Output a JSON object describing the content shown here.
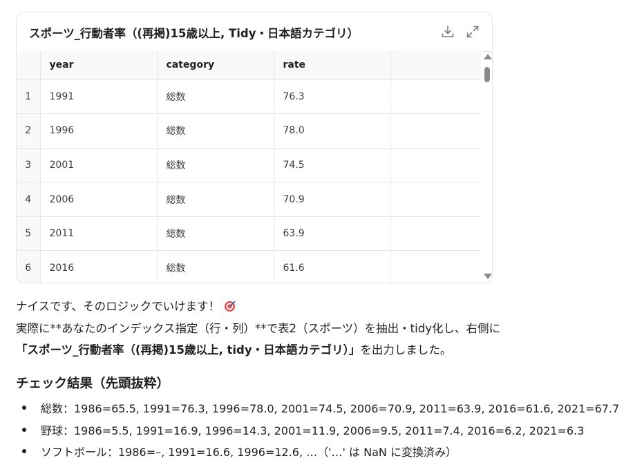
{
  "card": {
    "title": "スポーツ_行動者率（(再掲)15歳以上, Tidy・日本語カテゴリ）",
    "download_icon": "download-icon",
    "expand_icon": "expand-icon"
  },
  "table": {
    "columns": [
      "year",
      "category",
      "rate"
    ],
    "rows": [
      {
        "index": "1",
        "year": "1991",
        "category": "総数",
        "rate": "76.3"
      },
      {
        "index": "2",
        "year": "1996",
        "category": "総数",
        "rate": "78.0"
      },
      {
        "index": "3",
        "year": "2001",
        "category": "総数",
        "rate": "74.5"
      },
      {
        "index": "4",
        "year": "2006",
        "category": "総数",
        "rate": "70.9"
      },
      {
        "index": "5",
        "year": "2011",
        "category": "総数",
        "rate": "63.9"
      },
      {
        "index": "6",
        "year": "2016",
        "category": "総数",
        "rate": "61.6"
      }
    ]
  },
  "message": {
    "line1": "ナイスです、そのロジックでいけます！",
    "line1_emoji": "target-emoji-icon",
    "line2": "実際に**あなたのインデックス指定（行・列）**で表2（スポーツ）を抽出・tidy化し、右側に",
    "line3_bold": "「スポーツ_行動者率（(再掲)15歳以上, tidy・日本語カテゴリ）」",
    "line3_rest": "を出力しました。"
  },
  "check": {
    "title": "チェック結果（先頭抜粋）",
    "items": [
      "総数：1986=65.5, 1991=76.3, 1996=78.0, 2001=74.5, 2006=70.9, 2011=63.9, 2016=61.6, 2021=67.7",
      "野球：1986=5.5, 1991=16.9, 1996=14.3, 2001=11.9, 2006=9.5, 2011=7.4, 2016=6.2, 2021=6.3",
      "ソフトボール：1986=–, 1991=16.6, 1996=12.6, …（'…' は NaN に変換済み）"
    ]
  },
  "colors": {
    "border": "#e3e3e3",
    "header_bg": "#f9f9f9",
    "text": "#1f1f1f",
    "scrollbar": "#8a8a8a"
  }
}
